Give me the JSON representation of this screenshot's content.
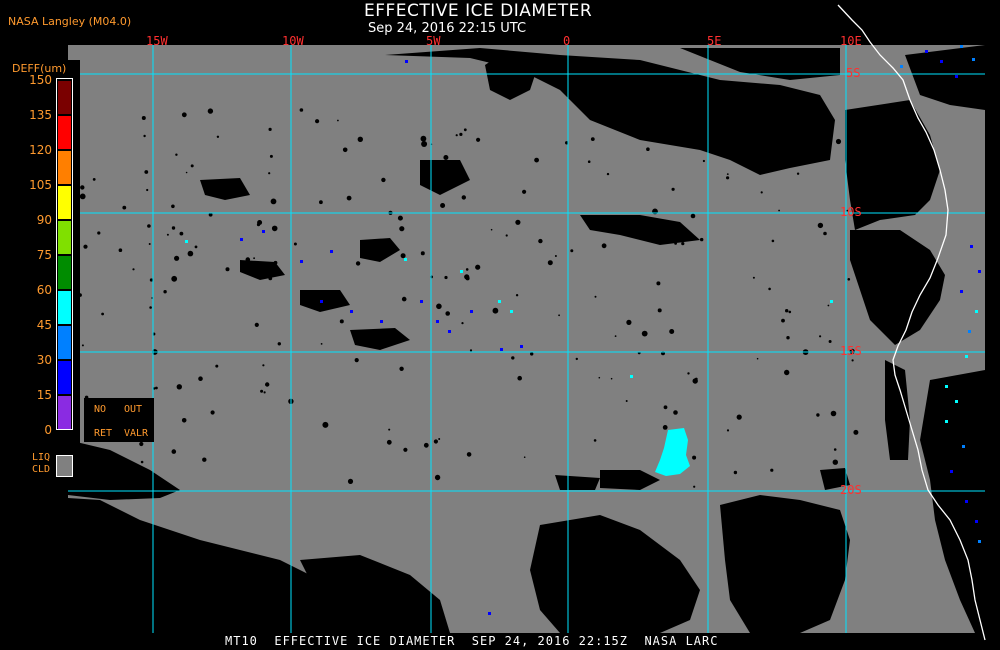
{
  "header": {
    "producer": "NASA Langley (M04.0)",
    "title": "EFFECTIVE ICE DIAMETER",
    "subtitle": "Sep 24, 2016 22:15 UTC"
  },
  "map": {
    "lon_labels": [
      "15W",
      "10W",
      "5W",
      "0",
      "5E",
      "10E"
    ],
    "lat_labels": [
      "5S",
      "10S",
      "15S",
      "20S"
    ],
    "gridline_color": "#00e5ff",
    "label_color": "#ff3030",
    "land_or_liquid_color": "#808080",
    "clear_color": "#000000",
    "coastline_color": "#ffffff"
  },
  "legend": {
    "unit_label": "DEFF(um)",
    "ticks": [
      "150",
      "135",
      "120",
      "105",
      "90",
      "75",
      "60",
      "45",
      "30",
      "15",
      "0"
    ],
    "colors": [
      "#7a0000",
      "#ff0000",
      "#ff7f00",
      "#ffff00",
      "#80e000",
      "#008c00",
      "#00ffff",
      "#0080ff",
      "#0000ff",
      "#8a2be2"
    ],
    "no_ret": {
      "line1": "NO",
      "line2": "RET",
      "color": "#000000"
    },
    "out_valr": {
      "line1": "OUT",
      "line2": "VALR",
      "color": "#000000"
    },
    "liq_cld": {
      "line1": "LIQ",
      "line2": "CLD",
      "color": "#808080"
    }
  },
  "footer": {
    "text": "MT10  EFFECTIVE ICE DIAMETER  SEP 24, 2016 22:15Z  NASA LARC"
  }
}
